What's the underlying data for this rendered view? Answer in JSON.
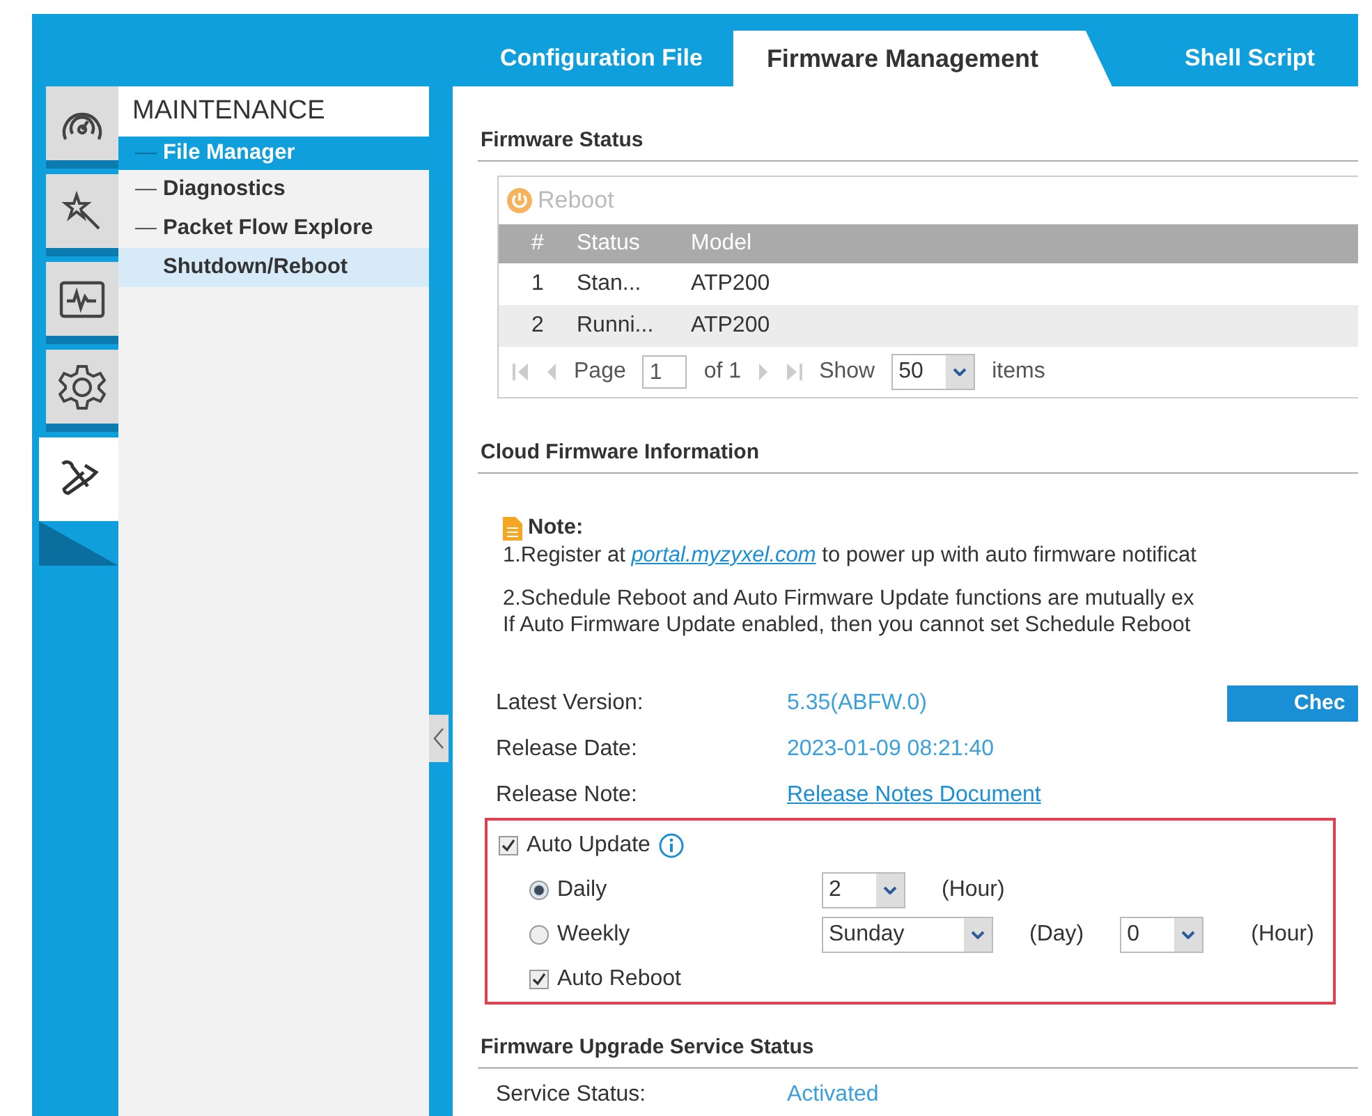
{
  "tabs": [
    {
      "label": "Configuration File",
      "selected": false
    },
    {
      "label": "Firmware Management",
      "selected": true
    },
    {
      "label": "Shell Script",
      "selected": false
    }
  ],
  "rail": [
    {
      "kind": "dashboard",
      "selected": false
    },
    {
      "kind": "wizard",
      "selected": false
    },
    {
      "kind": "monitor",
      "selected": false
    },
    {
      "kind": "settings",
      "selected": false
    },
    {
      "kind": "maintenance",
      "selected": true
    }
  ],
  "menu": {
    "title": "MAINTENANCE",
    "items": [
      {
        "marker": "—",
        "label": "File Manager",
        "selected": true,
        "highlighted": false
      },
      {
        "marker": "—",
        "label": "Diagnostics",
        "selected": false,
        "highlighted": false
      },
      {
        "marker": "—",
        "label": "Packet Flow Explore",
        "selected": false,
        "highlighted": false
      },
      {
        "label": "Shutdown/Reboot",
        "selected": false,
        "highlighted": true
      }
    ]
  },
  "firmware_status": {
    "title": "Firmware Status",
    "reboot_button": {
      "label": "Reboot",
      "disabled": true
    },
    "columns": [
      "#",
      "Status",
      "Model"
    ],
    "rows": [
      [
        "1",
        "Stan...",
        "ATP200"
      ],
      [
        "2",
        "Runni...",
        "ATP200"
      ]
    ],
    "pager": {
      "page_label": "Page",
      "page": "1",
      "of": "of 1",
      "show": "Show",
      "per_page": "50",
      "items": "items"
    }
  },
  "cloud": {
    "title": "Cloud Firmware Information",
    "note_title": "Note:",
    "note_1": {
      "before": "1.Register at ",
      "link": "portal.myzyxel.com",
      "after": " to power up with auto firmware notificat"
    },
    "note_2": [
      "2.Schedule Reboot and Auto Firmware Update functions are mutually ex",
      "If Auto Firmware Update enabled, then you cannot set Schedule Reboot"
    ],
    "fields": [
      {
        "kind": "value",
        "label": "Latest Version:",
        "value": "5.35(ABFW.0)"
      },
      {
        "kind": "value",
        "label": "Release Date:",
        "value": "2023-01-09 08:21:40"
      },
      {
        "kind": "link",
        "label": "Release Note:",
        "value": "Release Notes Document"
      }
    ],
    "check_button": "Chec",
    "auto_update": {
      "label": "Auto Update",
      "checked": true,
      "daily": {
        "label": "Daily",
        "selected": true,
        "hour": "2",
        "hour_unit": "(Hour)"
      },
      "weekly": {
        "label": "Weekly",
        "selected": false,
        "day": "Sunday",
        "day_unit": "(Day)",
        "hour": "0",
        "hour_unit": "(Hour)"
      },
      "auto_reboot": {
        "label": "Auto Reboot",
        "checked": true
      }
    }
  },
  "service": {
    "title": "Firmware Upgrade Service Status",
    "label": "Service Status:",
    "value": "Activated"
  }
}
